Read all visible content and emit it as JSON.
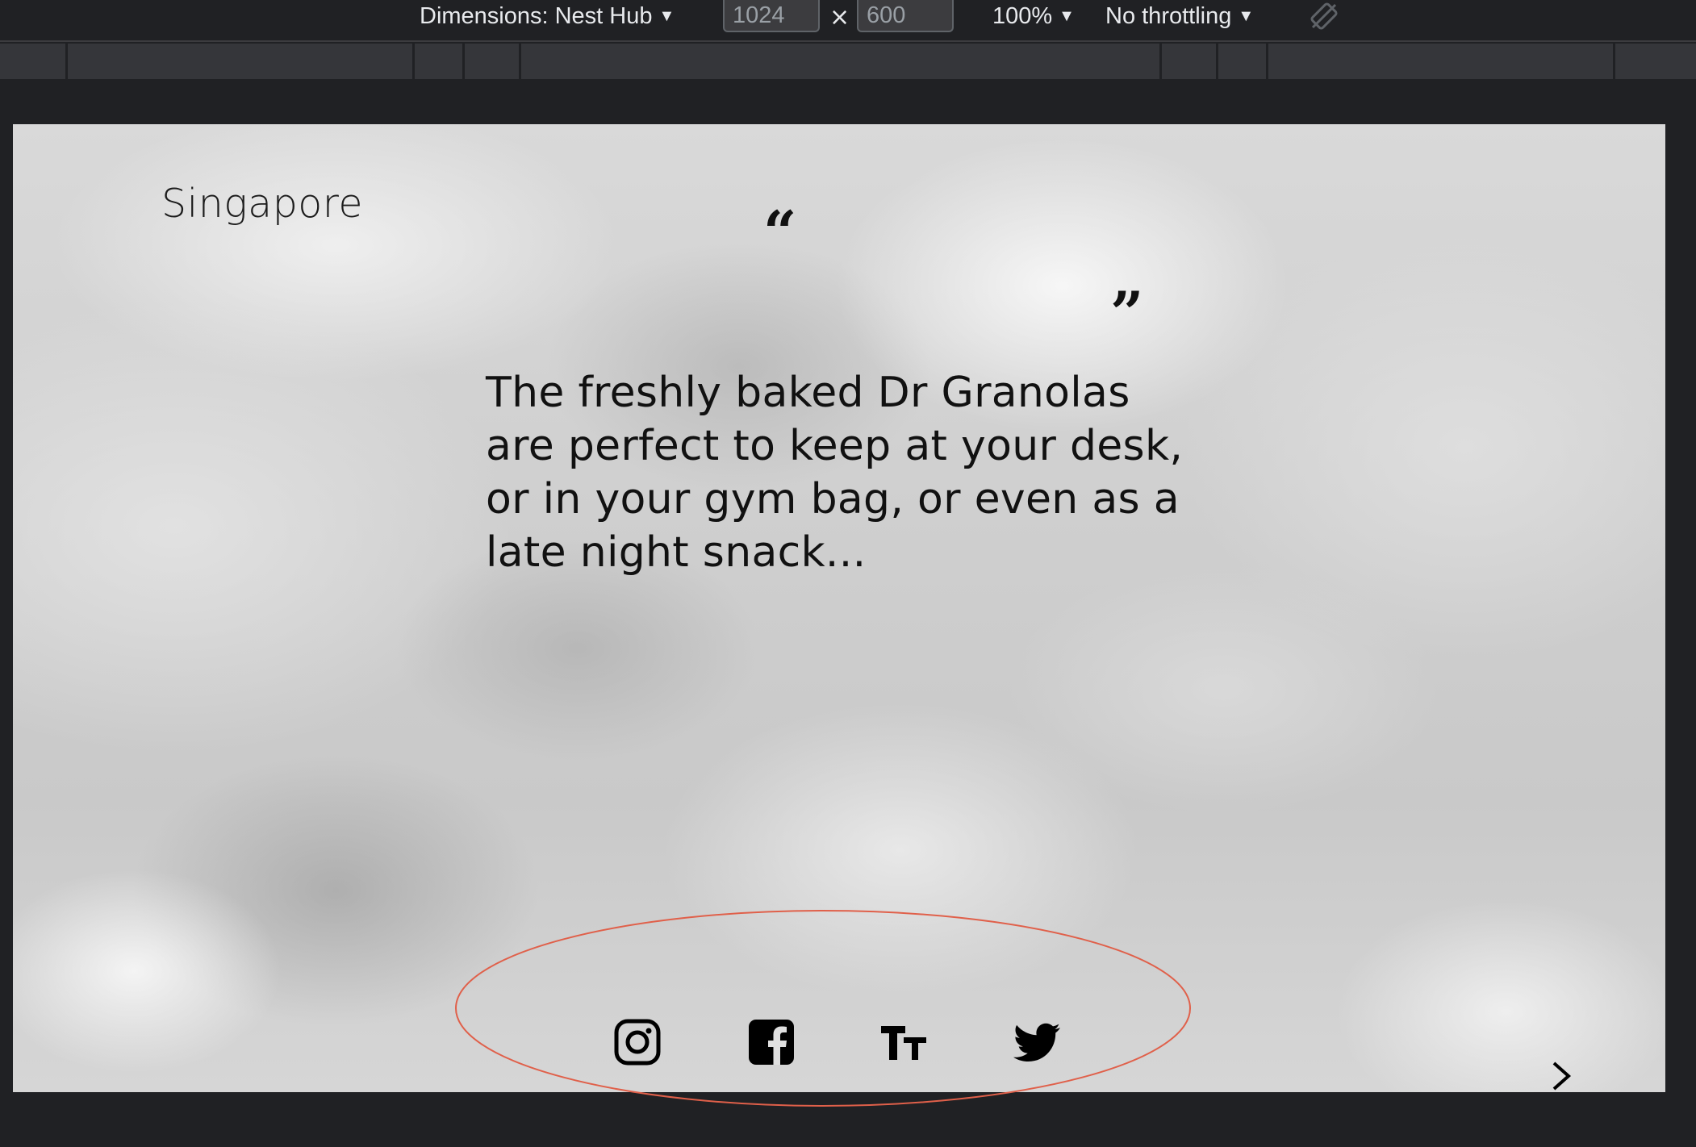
{
  "devtools": {
    "dimensions_label": "Dimensions: Nest Hub",
    "width_value": "1024",
    "height_value": "600",
    "times_symbol": "×",
    "zoom_label": "100%",
    "throttling_label": "No throttling",
    "caret": "▼",
    "icons": {
      "rotate": "rotate-icon"
    }
  },
  "page": {
    "city": "Singapore",
    "quote_open": "“",
    "quote_close": "”",
    "quote": "The freshly baked Dr Granolas are perfect to keep at your desk, or in your gym bag, or even as a late night snack...",
    "social": [
      {
        "name": "instagram-icon"
      },
      {
        "name": "facebook-icon"
      },
      {
        "name": "text-size-icon"
      },
      {
        "name": "twitter-icon"
      }
    ],
    "next_icon": "chevron-right-icon"
  },
  "colors": {
    "devtools_bg": "#202124",
    "annotation": "#e0604a",
    "text": "#111111"
  }
}
